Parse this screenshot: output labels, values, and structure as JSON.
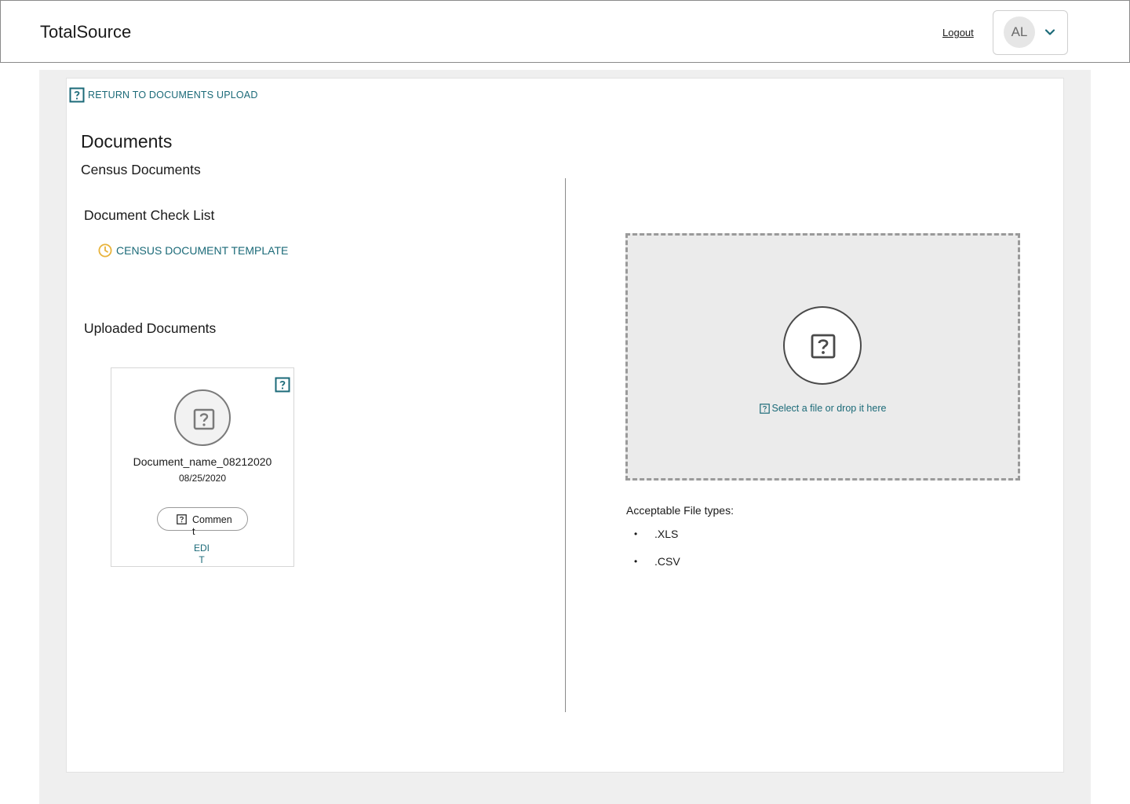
{
  "header": {
    "brand": "TotalSource",
    "logout_label": "Logout",
    "user_initials": "AL",
    "chevron_icon": "chevron-down-icon"
  },
  "nav": {
    "return_label": "RETURN TO DOCUMENTS UPLOAD",
    "return_icon": "back-icon"
  },
  "page": {
    "title": "Documents",
    "subtitle": "Census Documents"
  },
  "checklist": {
    "title": "Document Check List",
    "items": [
      {
        "label": "CENSUS DOCUMENT TEMPLATE",
        "status_icon": "clock-icon"
      }
    ]
  },
  "uploaded": {
    "title": "Uploaded Documents",
    "documents": [
      {
        "name": "Document_name_08212020",
        "date": "08/25/2020",
        "comment_label": "Comment",
        "edit_label": "EDIT"
      }
    ]
  },
  "upload": {
    "dropzone_text": "Select a file or drop it here",
    "acceptable_label": "Acceptable File types:",
    "file_types": [
      ".XLS",
      ".CSV"
    ]
  },
  "colors": {
    "accent": "#1b6a78",
    "pending": "#e8b33b",
    "panel_bg": "#efefef",
    "dropzone_bg": "#ebebeb"
  }
}
